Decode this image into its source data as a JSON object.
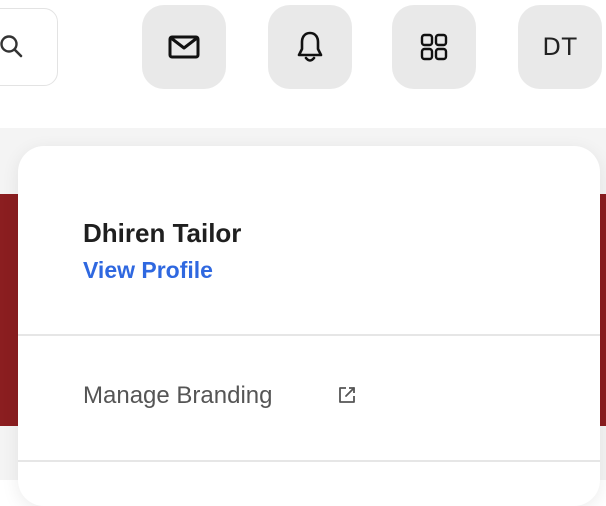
{
  "header": {
    "search_icon": "search-icon",
    "mail_icon": "mail-icon",
    "bell_icon": "bell-icon",
    "apps_icon": "grid-icon",
    "avatar_initials": "DT"
  },
  "profile": {
    "name": "Dhiren Tailor",
    "view_profile_label": "View Profile"
  },
  "menu": {
    "items": [
      {
        "label": "Manage Branding",
        "icon": "external-link-icon"
      }
    ]
  },
  "colors": {
    "link": "#2f68e0",
    "brand_strip": "#8b1e20",
    "icon_button_bg": "#e9e9e9"
  }
}
